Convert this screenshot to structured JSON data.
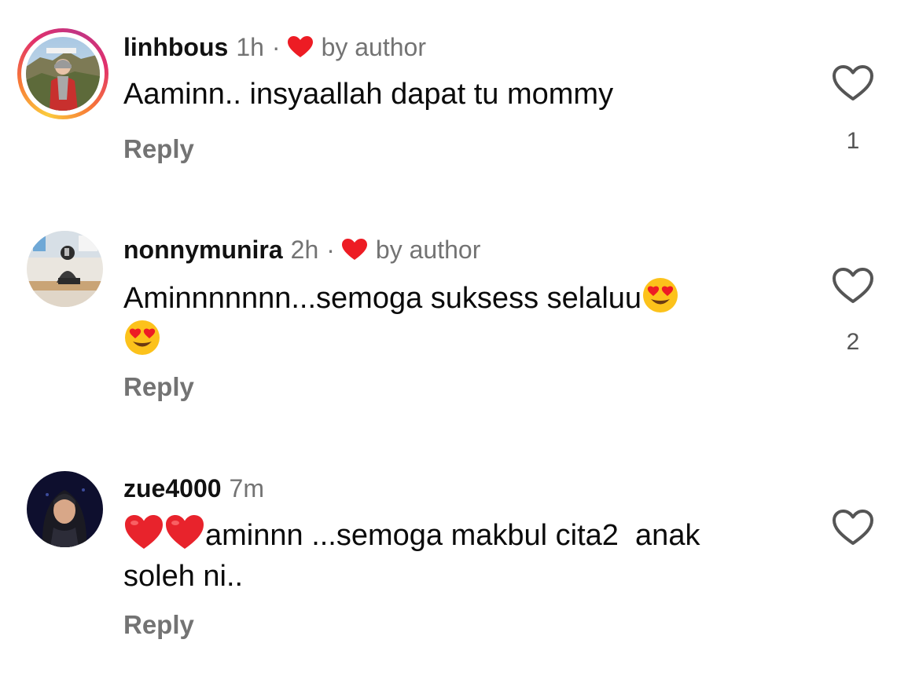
{
  "comments": [
    {
      "username": "linhbous",
      "time": "1h",
      "separator": "·",
      "author_liked_label": "by author",
      "text": "Aaminn.. insyaallah dapat tu mommy",
      "reply_label": "Reply",
      "like_count": "1",
      "avatar_icon": "avatar-photo-with-story-ring",
      "like_icon": "heart-outline-icon"
    },
    {
      "username": "nonnymunira",
      "time": "2h",
      "separator": "·",
      "author_liked_label": "by author",
      "text_line1": "Aminnnnnnn...semoga suksess selaluu",
      "reply_label": "Reply",
      "like_count": "2",
      "emoji": "smiling-face-with-heart-eyes",
      "like_icon": "heart-outline-icon"
    },
    {
      "username": "zue4000",
      "time": "7m",
      "text_line1": "aminnn ...semoga makbul cita2  anak",
      "text_line2": "soleh ni..",
      "reply_label": "Reply",
      "emoji": "red-heart",
      "like_icon": "heart-outline-icon"
    }
  ],
  "colors": {
    "heart_red": "#ed1c24",
    "muted_text": "#737373",
    "primary_text": "#0b0b0b"
  }
}
